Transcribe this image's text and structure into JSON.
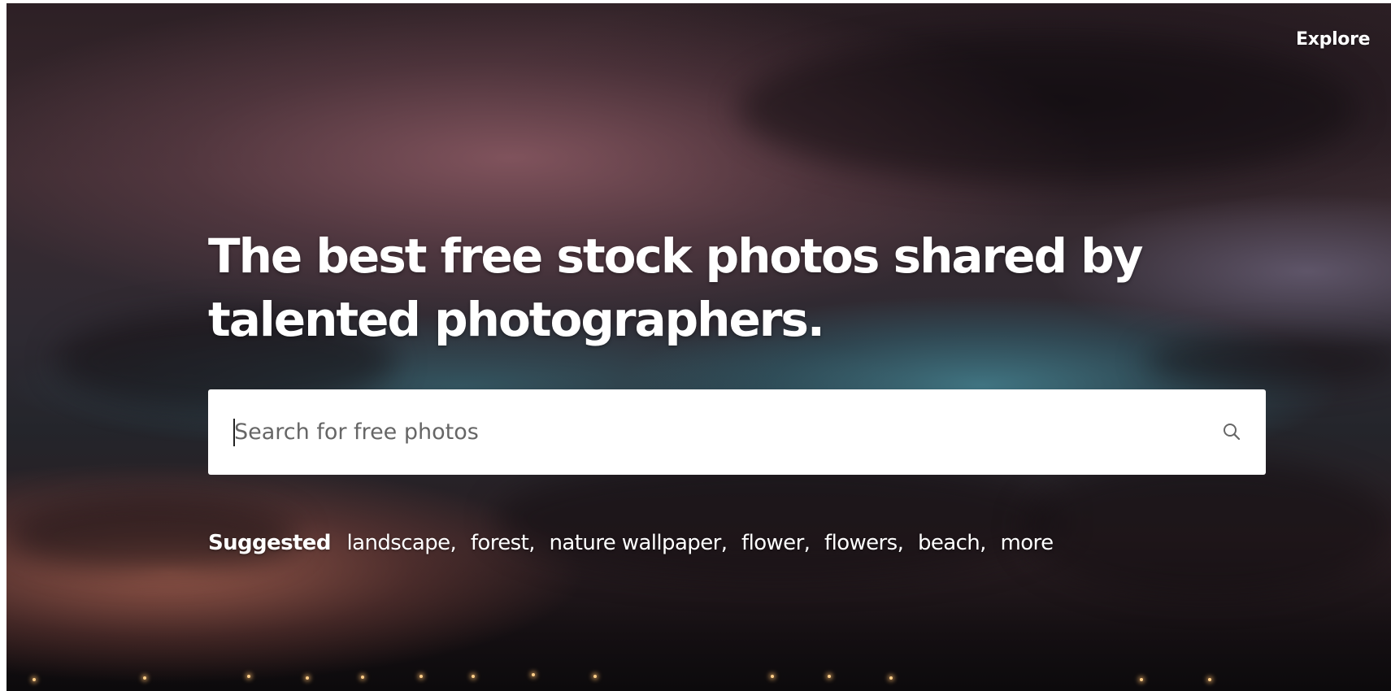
{
  "nav": {
    "explore_label": "Explore"
  },
  "hero": {
    "headline_line1": "The best free stock photos shared by",
    "headline_line2": "talented photographers."
  },
  "search": {
    "placeholder": "Search for free photos",
    "icon": "search-icon"
  },
  "suggested": {
    "label": "Suggested",
    "items": [
      "landscape",
      "forest",
      "nature wallpaper",
      "flower",
      "flowers",
      "beach",
      "more"
    ]
  },
  "colors": {
    "text": "#ffffff",
    "search_bg": "#ffffff",
    "placeholder": "#666666"
  }
}
